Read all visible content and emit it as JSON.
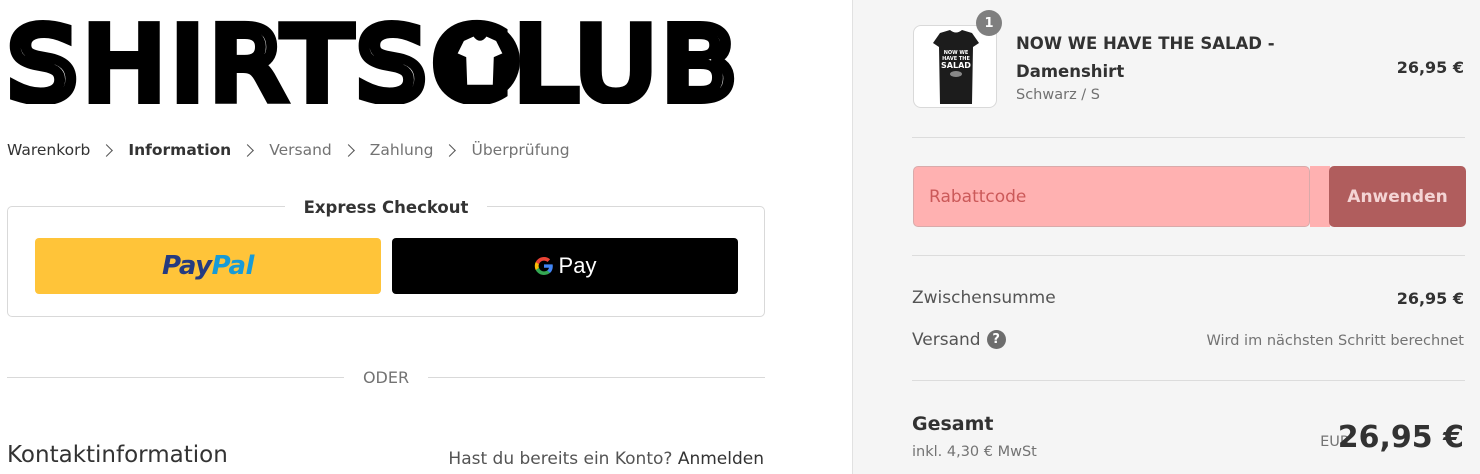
{
  "brand": {
    "logo_text": "SHIRTSCLUB"
  },
  "breadcrumb": {
    "items": [
      "Warenkorb",
      "Information",
      "Versand",
      "Zahlung",
      "Überprüfung"
    ],
    "current_index": 1
  },
  "express_checkout": {
    "title": "Express Checkout",
    "paypal_label_1": "Pay",
    "paypal_label_2": "Pal",
    "gpay_label": "Pay"
  },
  "divider_text": "ODER",
  "contact": {
    "title": "Kontaktinformation",
    "login_prompt": "Hast du bereits ein Konto?",
    "login_link": "Anmelden"
  },
  "cart": {
    "items": [
      {
        "name": "NOW WE HAVE THE SALAD - Damenshirt",
        "variant": "Schwarz / S",
        "price": "26,95 €",
        "quantity": "1",
        "shirt_print": [
          "NOW WE",
          "HAVE THE",
          "SALAD"
        ]
      }
    ]
  },
  "coupon": {
    "placeholder": "Rabattcode",
    "button_label": "Anwenden"
  },
  "summary": {
    "subtotal_label": "Zwischensumme",
    "subtotal_value": "26,95 €",
    "shipping_label": "Versand",
    "shipping_value": "Wird im nächsten Schritt berechnet",
    "total_label": "Gesamt",
    "tax_note": "inkl. 4,30 € MwSt",
    "currency": "EUR",
    "total_value": "26,95 €"
  },
  "colors": {
    "coupon_bg": "#ffb1b1",
    "coupon_button": "#b05d5d",
    "paypal_yellow": "#ffc439",
    "gpay_black": "#000000",
    "sidebar_bg": "#f5f5f5"
  }
}
